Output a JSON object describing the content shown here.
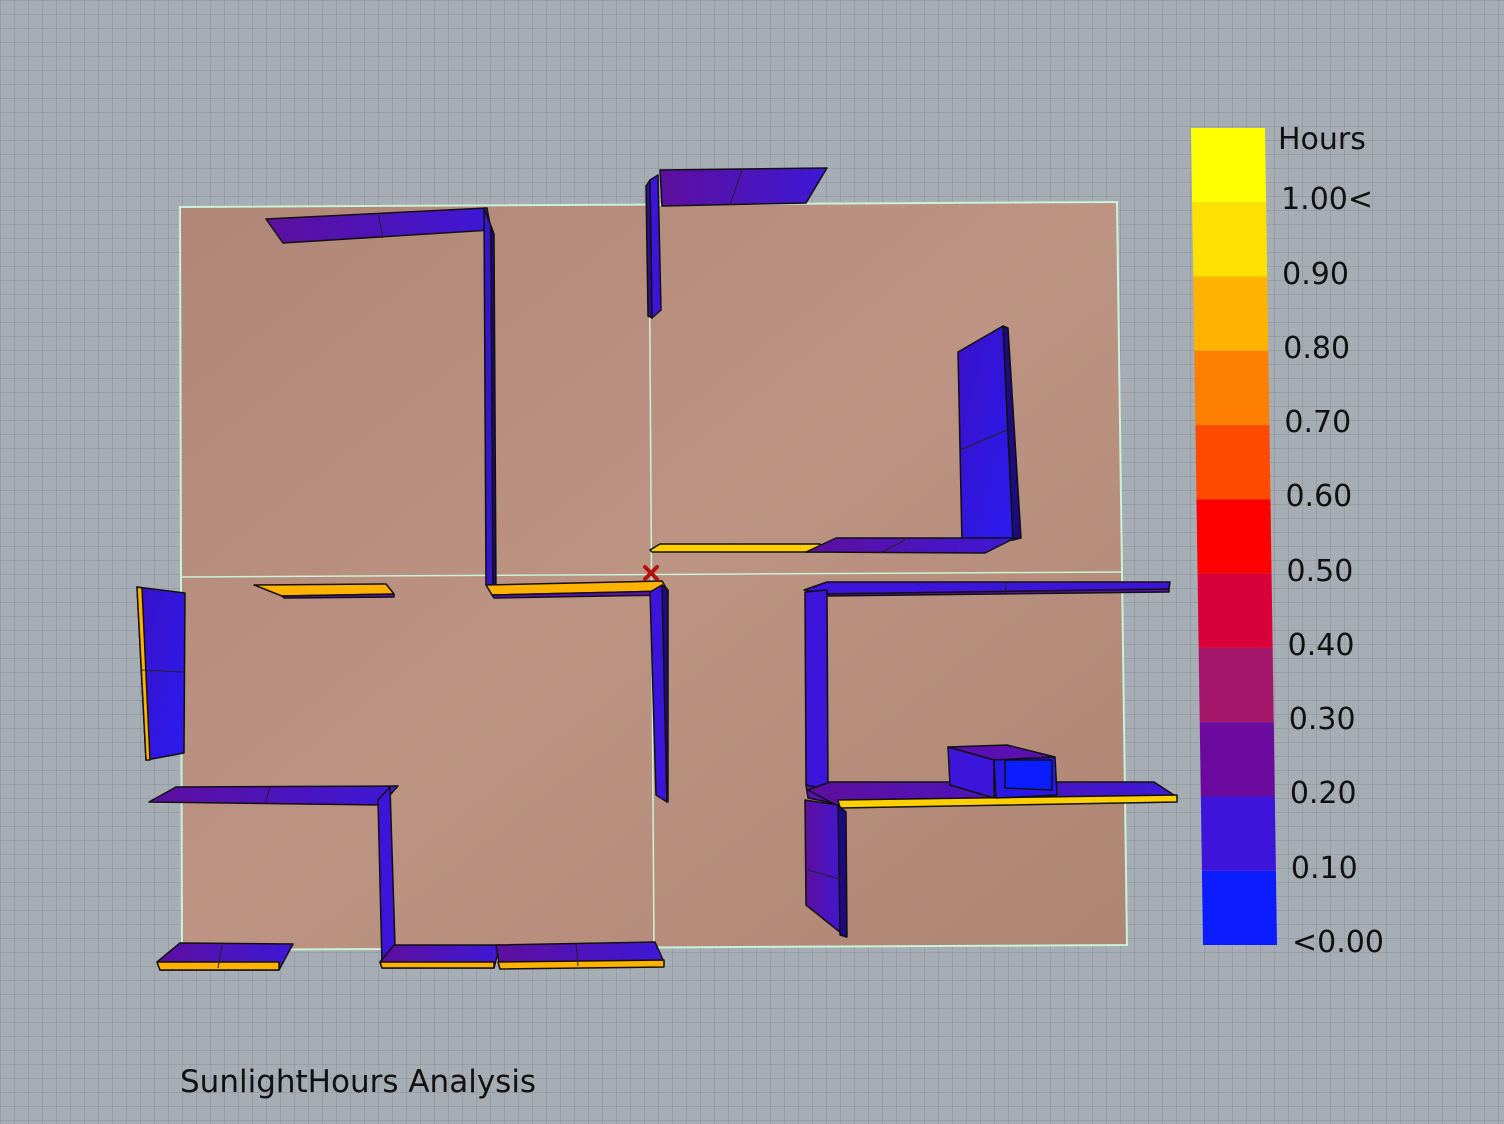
{
  "caption": "SunlightHours Analysis",
  "legend": {
    "title": "Hours",
    "labels": [
      "1.00<",
      "0.90",
      "0.80",
      "0.70",
      "0.60",
      "0.50",
      "0.40",
      "0.30",
      "0.20",
      "0.10",
      "<0.00"
    ],
    "colors": [
      "#ffff00",
      "#ffe100",
      "#ffb300",
      "#ff8000",
      "#ff4b00",
      "#ff0000",
      "#d9003a",
      "#a4166a",
      "#6c0aa0",
      "#3d14d9",
      "#0b1cff"
    ]
  },
  "colors": {
    "floor": "#b98d7c",
    "floor_edge": "#c9f2d8",
    "wall_low": "#3d14d9",
    "wall_mid": "#5b0fb0",
    "wall_high": "#ffb300",
    "marker": "#b3120f"
  }
}
